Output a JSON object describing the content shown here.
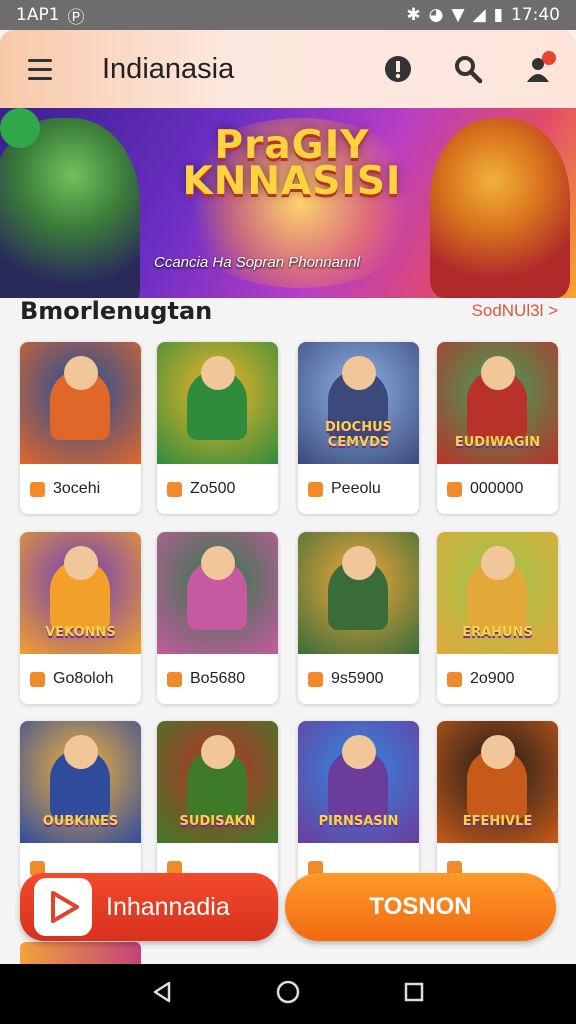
{
  "status_bar": {
    "time_left": "1AP1",
    "time_right": "17:40"
  },
  "header": {
    "title": "Indianasia",
    "icons": [
      "menu-icon",
      "info-icon",
      "search-icon",
      "user-icon"
    ]
  },
  "banner": {
    "title_line1": "PraGIY",
    "title_line2": "KNNASISI",
    "subtitle": "Ccancia Ha Sopran Phonnannl"
  },
  "section": {
    "title": "Bmorlenugtan",
    "more": "SodNUl3l >"
  },
  "games": [
    {
      "value": "3ocehi",
      "colors": [
        "#1d4f9c",
        "#e0672a"
      ],
      "label": ""
    },
    {
      "value": "Zo500",
      "colors": [
        "#f2b52a",
        "#2f8c3c"
      ],
      "label": ""
    },
    {
      "value": "Peeolu",
      "colors": [
        "#8fb3e8",
        "#3b4a7a"
      ],
      "label": "DIOCHUS CEMVDS"
    },
    {
      "value": "000000",
      "colors": [
        "#3fa35a",
        "#b8322a"
      ],
      "label": "EUDIWAGIN"
    },
    {
      "value": "Go8oloh",
      "colors": [
        "#6c3cc0",
        "#f2a02a"
      ],
      "label": "VEKONNS"
    },
    {
      "value": "Bo5680",
      "colors": [
        "#2f7a4a",
        "#c65aa0"
      ],
      "label": ""
    },
    {
      "value": "9s5900",
      "colors": [
        "#f3a83a",
        "#3a6c3a"
      ],
      "label": ""
    },
    {
      "value": "2o900",
      "colors": [
        "#9bc64a",
        "#e2a83a"
      ],
      "label": "ERAHUNS"
    },
    {
      "value": "",
      "colors": [
        "#f4b23a",
        "#2f4c9c"
      ],
      "label": "OUBKINES"
    },
    {
      "value": "",
      "colors": [
        "#b8322a",
        "#3f7a2a"
      ],
      "label": "SUDISAKN"
    },
    {
      "value": "",
      "colors": [
        "#2f8ae0",
        "#6c3c9c"
      ],
      "label": "PIRNSASIN"
    },
    {
      "value": "",
      "colors": [
        "#1b1b1b",
        "#c65a1a"
      ],
      "label": "EFEHIVLE"
    }
  ],
  "buttons": {
    "left_label": "Inhannadia",
    "right_label": "TOSNON"
  }
}
